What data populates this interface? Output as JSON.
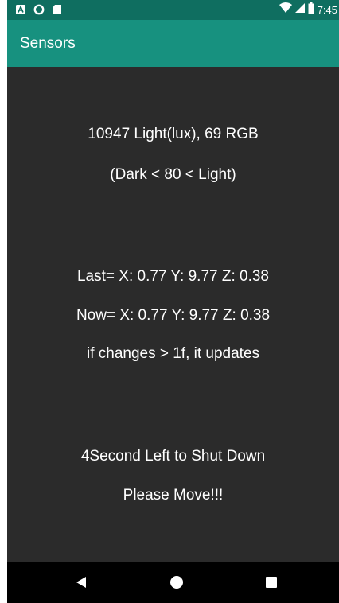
{
  "status_bar": {
    "time": "7:45",
    "icons": [
      "notification-a-icon",
      "circle-icon",
      "sd-card-icon",
      "wifi-icon",
      "signal-icon",
      "battery-icon"
    ]
  },
  "app_bar": {
    "title": "Sensors"
  },
  "light": {
    "reading": "10947 Light(lux), 69 RGB",
    "threshold": "(Dark < 80 < Light)"
  },
  "accelerometer": {
    "last": "Last= X: 0.77 Y: 9.77 Z: 0.38",
    "now": "Now= X: 0.77 Y: 9.77 Z: 0.38",
    "rule": "if changes > 1f, it updates"
  },
  "shutdown": {
    "countdown": "4Second Left to Shut Down",
    "prompt": "Please Move!!!"
  },
  "nav_bar": {
    "icons": [
      "back-icon",
      "home-icon",
      "recents-icon"
    ]
  },
  "colors": {
    "status_bar": "#0f6e60",
    "app_bar": "#17917f",
    "background": "#2b2b2b",
    "nav_bar": "#000000",
    "text": "#ffffff"
  }
}
